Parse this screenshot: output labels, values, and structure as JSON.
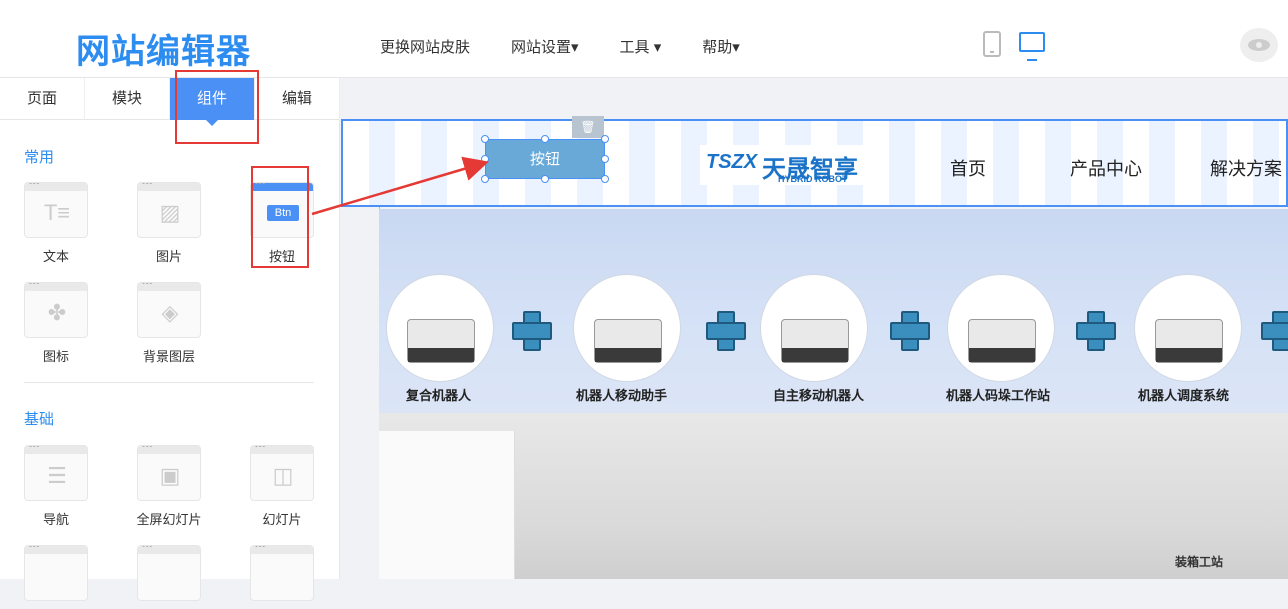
{
  "header": {
    "logo": "网站编辑器",
    "menu": [
      "更换网站皮肤",
      "网站设置▾",
      "工具 ▾",
      "帮助▾"
    ]
  },
  "sidebar": {
    "tabs": [
      "页面",
      "模块",
      "组件",
      "编辑"
    ],
    "active_tab": "组件",
    "sections": {
      "common": {
        "title": "常用",
        "items": [
          "文本",
          "图片",
          "按钮",
          "图标",
          "背景图层"
        ]
      },
      "basic": {
        "title": "基础",
        "items": [
          "导航",
          "全屏幻灯片",
          "幻灯片"
        ]
      }
    }
  },
  "canvas": {
    "button_widget": "按钮",
    "site_logo": {
      "abbr": "TSZX",
      "name": "天晟智享",
      "sub": "HYBRID ROBOT"
    },
    "nav": [
      "首页",
      "产品中心",
      "解决方案"
    ],
    "products": [
      "复合机器人",
      "机器人移动助手",
      "自主移动机器人",
      "机器人码垛工作站",
      "机器人调度系统"
    ],
    "photo_label": "装箱工站"
  },
  "colors": {
    "accent": "#4a90f5",
    "annotation": "#e53935"
  }
}
